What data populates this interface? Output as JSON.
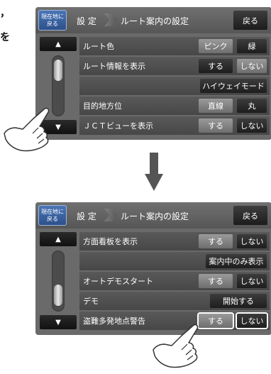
{
  "margin_text": [
    "，",
    "を"
  ],
  "screen1": {
    "current_location_btn": "現在地に\n戻る",
    "crumb_settings": "設 定",
    "crumb_route": "ルート案内の設定",
    "back": "戻る",
    "rows": [
      {
        "label": "ルート色",
        "options": [
          "ピンク",
          "緑"
        ],
        "selected": 0
      },
      {
        "label": "ルート情報を表示",
        "options": [
          "する",
          "しない"
        ],
        "selected": 1
      },
      {
        "label": "",
        "options": [
          "ハイウェイモード"
        ],
        "selected": -1
      },
      {
        "label": "目的地方位",
        "options": [
          "直線",
          "丸"
        ],
        "selected": 0
      },
      {
        "label": "ＪＣＴビューを表示",
        "options": [
          "する",
          "しない"
        ],
        "selected": 0
      }
    ]
  },
  "screen2": {
    "current_location_btn": "現在地に\n戻る",
    "crumb_settings": "設 定",
    "crumb_route": "ルート案内の設定",
    "back": "戻る",
    "rows": [
      {
        "label": "方面看板を表示",
        "options": [
          "する",
          "しない"
        ],
        "selected": 0
      },
      {
        "label": "",
        "options": [
          "案内中のみ表示"
        ],
        "selected": -1
      },
      {
        "label": "オートデモスタート",
        "options": [
          "する",
          "しない"
        ],
        "selected": 0
      },
      {
        "label": "デモ",
        "options": [
          "開始する"
        ],
        "selected": -1
      },
      {
        "label": "盗難多発地点警告",
        "options": [
          "する",
          "しない"
        ],
        "selected": 0
      }
    ]
  },
  "icons": {
    "scroll_up": "▲",
    "scroll_down": "▼",
    "transition": "down-arrow-icon",
    "hand": "pointing-hand-icon"
  }
}
